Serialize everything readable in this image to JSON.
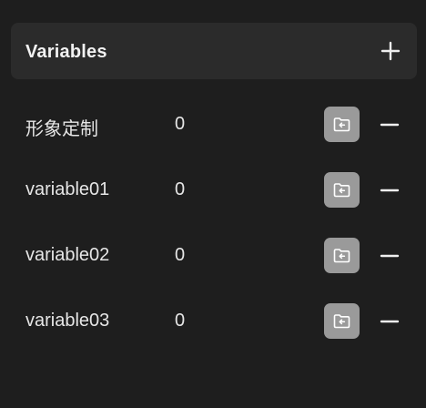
{
  "panel": {
    "title": "Variables",
    "add_icon": "plus-icon"
  },
  "variables": [
    {
      "name": "形象定制",
      "value": "0",
      "folder_icon": "folder-icon",
      "remove_icon": "minus-icon"
    },
    {
      "name": "variable01",
      "value": "0",
      "folder_icon": "folder-icon",
      "remove_icon": "minus-icon"
    },
    {
      "name": "variable02",
      "value": "0",
      "folder_icon": "folder-icon",
      "remove_icon": "minus-icon"
    },
    {
      "name": "variable03",
      "value": "0",
      "folder_icon": "folder-icon",
      "remove_icon": "minus-icon"
    }
  ],
  "colors": {
    "background": "#1e1e1e",
    "header_background": "#2b2b2b",
    "text": "#e6e6e6",
    "folder_button": "#9a9a9a"
  }
}
